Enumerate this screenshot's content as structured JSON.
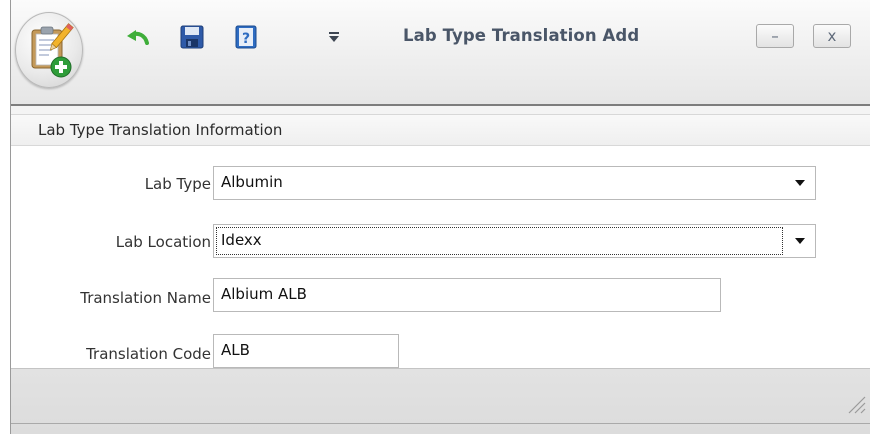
{
  "window": {
    "title": "Lab Type Translation Add",
    "minimize_glyph": "–",
    "close_glyph": "x"
  },
  "quick_access_toolbar": {
    "items": [
      {
        "icon": "undo-icon"
      },
      {
        "icon": "save-icon"
      },
      {
        "icon": "help-icon"
      },
      {
        "icon": "customize-toolbar-icon"
      }
    ]
  },
  "group": {
    "title": "Lab Type Translation Information"
  },
  "form": {
    "lab_type": {
      "label": "Lab Type",
      "value": "Albumin"
    },
    "lab_location": {
      "label": "Lab Location",
      "value": "Idexx"
    },
    "translation_name": {
      "label": "Translation Name",
      "value": "Albium ALB"
    },
    "translation_code": {
      "label": "Translation Code",
      "value": "ALB"
    }
  },
  "colors": {
    "title_text": "#4a5668",
    "border": "#b9b9b9",
    "undo_green": "#3fae3a",
    "save_blue": "#2e5aa8"
  }
}
